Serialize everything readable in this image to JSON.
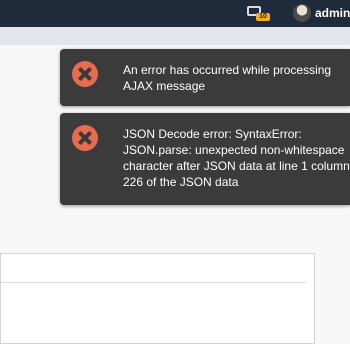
{
  "navbar": {
    "notification_count": "10",
    "username": "admin",
    "notification_icon": "monitor-icon",
    "avatar_icon": "avatar"
  },
  "toasts": [
    {
      "icon": "error-close-icon",
      "message": "An error has occurred while processing AJAX message"
    },
    {
      "icon": "error-close-icon",
      "message": "JSON Decode error: SyntaxError: JSON.parse: unexpected non-whitespace character after JSON data at line 1 column 226 of the JSON data"
    }
  ],
  "colors": {
    "navbar": "#1f2a3a",
    "toast_bg": "#3b3b3b",
    "error_icon": "#e96b4f",
    "badge": "#f0ad1f"
  }
}
